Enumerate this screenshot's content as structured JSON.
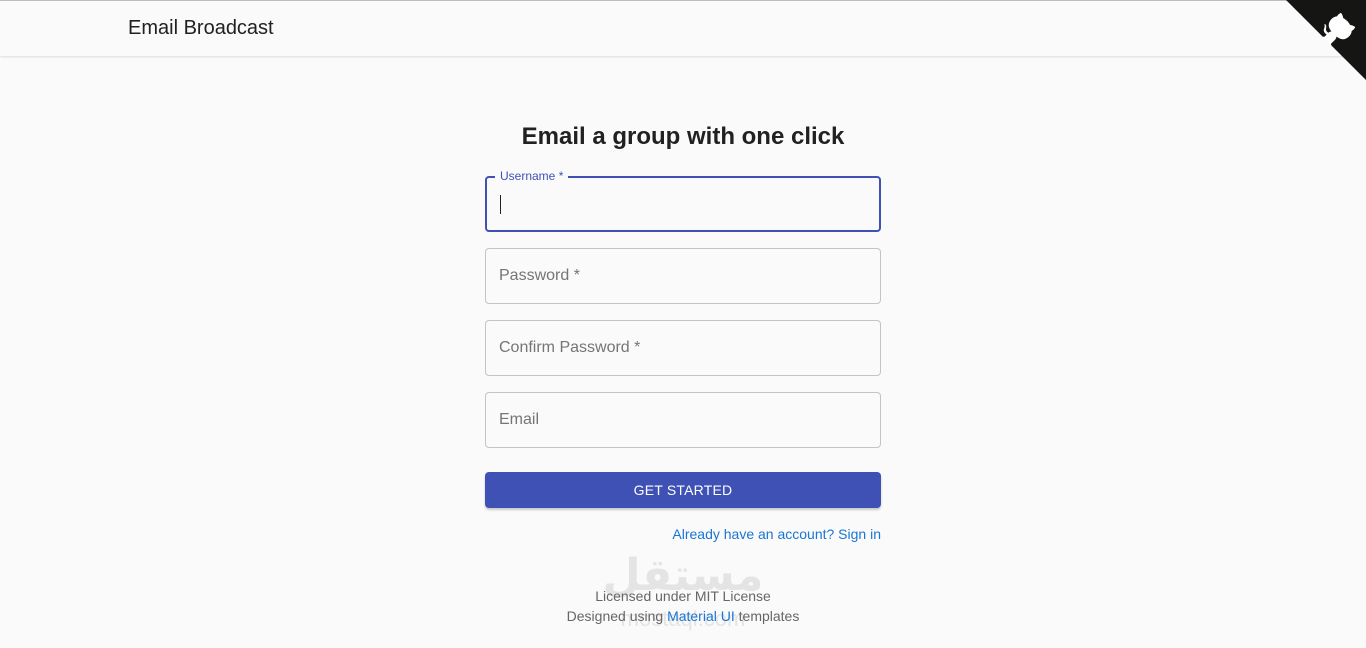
{
  "header": {
    "title": "Email Broadcast",
    "corner_icon": "github-octocat-icon"
  },
  "form": {
    "heading": "Email a group with one click",
    "fields": [
      {
        "label": "Username *",
        "value": "",
        "focused": true
      },
      {
        "label": "Password *",
        "value": "",
        "focused": false
      },
      {
        "label": "Confirm Password *",
        "value": "",
        "focused": false
      },
      {
        "label": "Email",
        "value": "",
        "focused": false
      }
    ],
    "submit_label": "GET STARTED",
    "signin_link": "Already have an account? Sign in"
  },
  "footer": {
    "line1": "Licensed under MIT License",
    "line2_prefix": "Designed using ",
    "line2_link": "Material UI",
    "line2_suffix": " templates"
  },
  "watermark": {
    "arabic": "مستقل",
    "latin": "mostaql.com"
  },
  "colors": {
    "primary": "#3f51b5",
    "link": "#1976d2",
    "background": "#fafafa"
  }
}
